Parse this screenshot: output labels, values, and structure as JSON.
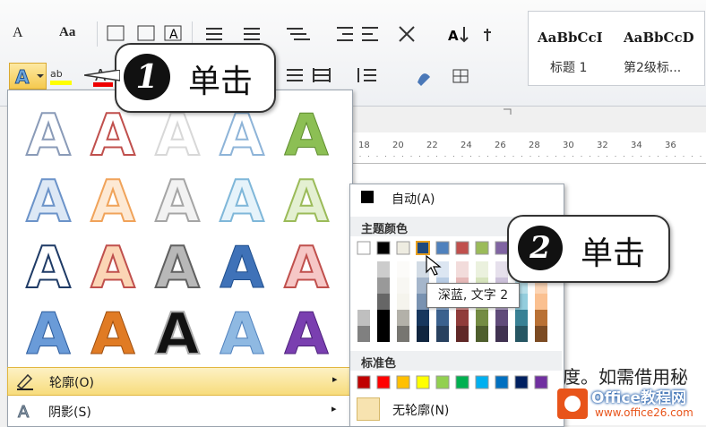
{
  "ribbon": {
    "font_size_grow": "A",
    "change_case": "Aa",
    "styles": [
      {
        "sample": "AaBbCcI",
        "name": "标题 1"
      },
      {
        "sample": "AaBbCcD",
        "name": "第2级标..."
      }
    ]
  },
  "ruler": {
    "ticks": [
      "18",
      "20",
      "22",
      "24",
      "26",
      "28",
      "30",
      "32",
      "34",
      "36"
    ]
  },
  "text_effects_menu": {
    "gallery_glyph": "A",
    "outline_label": "轮廓(O)",
    "shadow_label": "阴影(S)",
    "submenu_arrow": "▸"
  },
  "outline_color_menu": {
    "auto_label": "自动(A)",
    "theme_colors_label": "主题颜色",
    "standard_colors_label": "标准色",
    "no_outline_label": "无轮廓(N)",
    "theme_colors": [
      "#ffffff",
      "#000000",
      "#eeece1",
      "#1f497d",
      "#4f81bd",
      "#c0504d",
      "#9bbb59",
      "#8064a2",
      "#4bacc6",
      "#f79646"
    ],
    "standard_colors": [
      "#c00000",
      "#ff0000",
      "#ffc000",
      "#ffff00",
      "#92d050",
      "#00b050",
      "#00b0f0",
      "#0070c0",
      "#002060",
      "#7030a0"
    ]
  },
  "tooltip": "深蓝, 文字 2",
  "callouts": [
    {
      "number": "1",
      "text": "单击"
    },
    {
      "number": "2",
      "text": "单击"
    }
  ],
  "document": {
    "visible_text": "度。如需借用秘"
  },
  "watermark": {
    "brand": "Office教程网",
    "url": "www.office26.com"
  }
}
